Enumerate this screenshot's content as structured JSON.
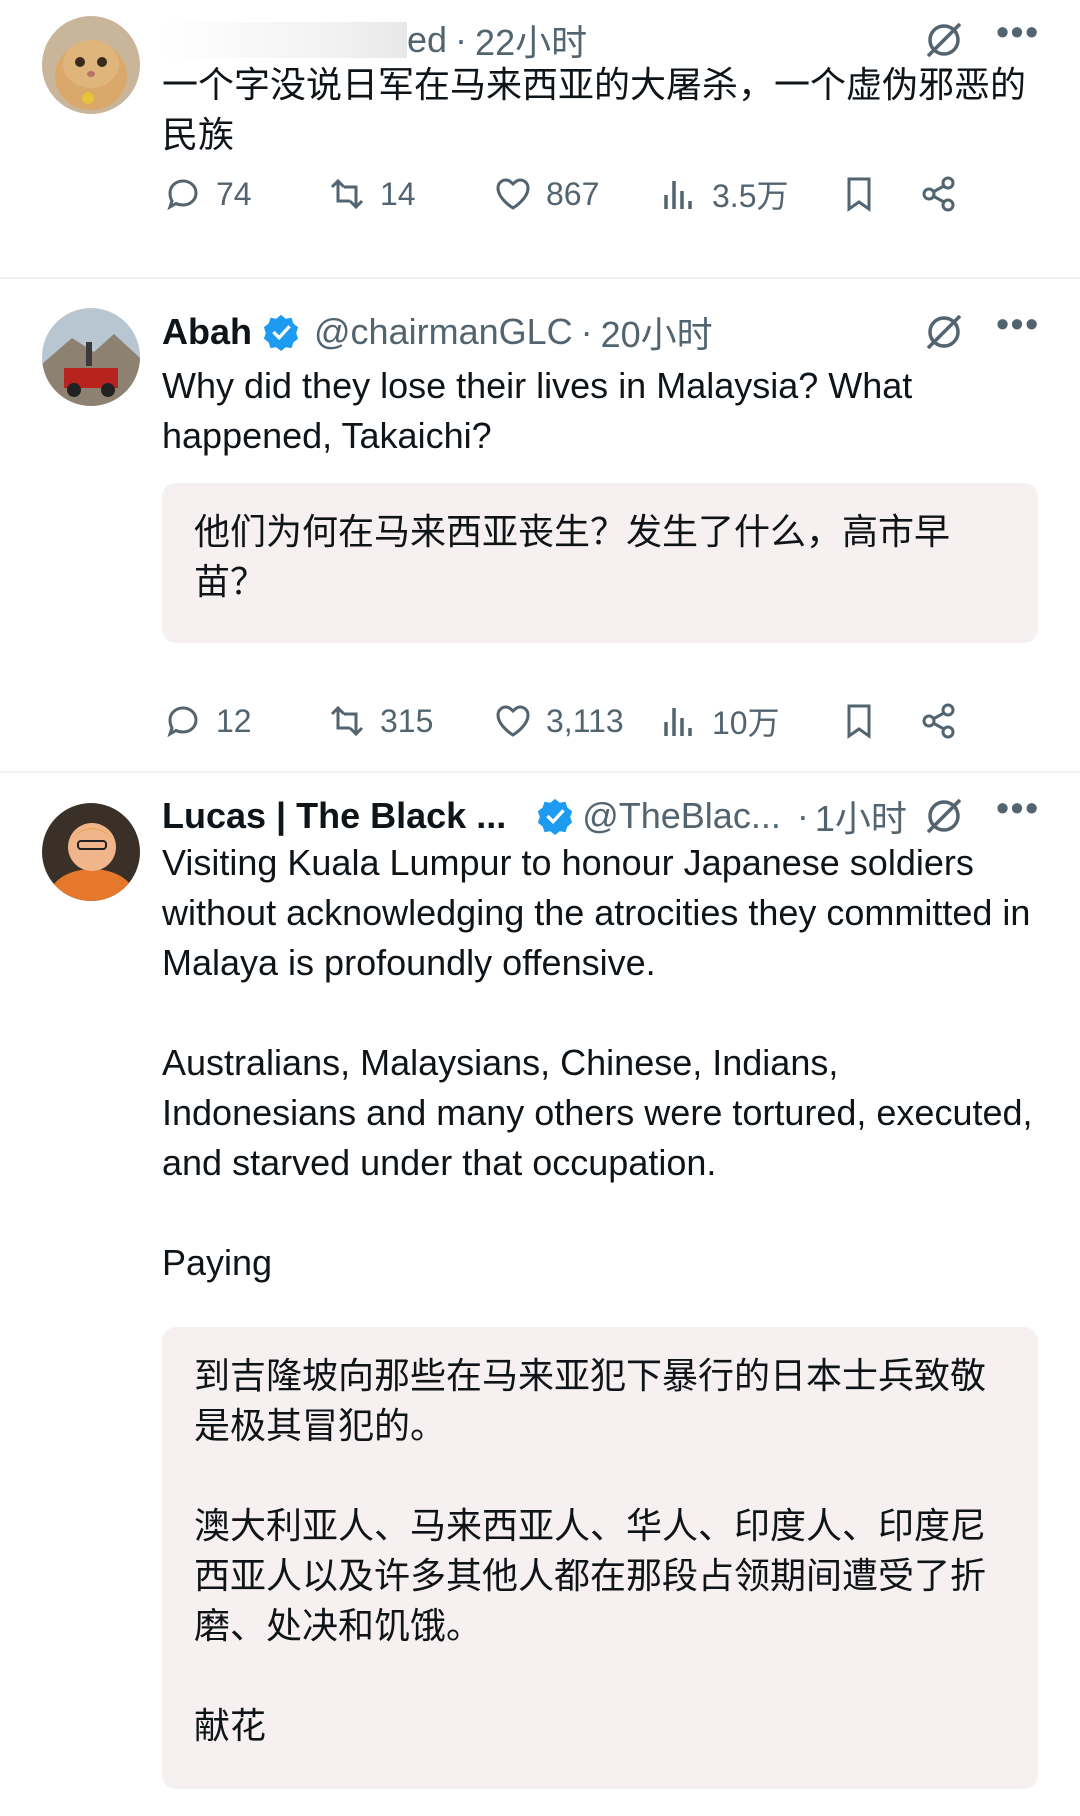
{
  "tweets": [
    {
      "name": "",
      "handle_partial": "ed",
      "time": "22小时",
      "text": "一个字没说日军在马来西亚的大屠杀，一个虚伪邪恶的民族",
      "replies": "74",
      "retweets": "14",
      "likes": "867",
      "views": "3.5万"
    },
    {
      "name": "Abah",
      "handle": "@chairmanGLC",
      "time": "20小时",
      "text": "Why did they lose their lives in Malaysia? What happened, Takaichi?",
      "translation": "他们为何在马来西亚丧生？发生了什么，高市早苗？",
      "replies": "12",
      "retweets": "315",
      "likes": "3,113",
      "views": "10万"
    },
    {
      "name": "Lucas | The Black ...",
      "handle": "@TheBlac...",
      "time": "1小时",
      "text": "Visiting Kuala Lumpur to honour Japanese soldiers without acknowledging the atrocities they committed in Malaya is profoundly offensive.\n\nAustralians, Malaysians, Chinese, Indians, Indonesians and many others were tortured, executed, and starved under that occupation.\n\nPaying",
      "translation": "到吉隆坡向那些在马来亚犯下暴行的日本士兵致敬是极其冒犯的。\n\n澳大利亚人、马来西亚人、华人、印度人、印度尼西亚人以及许多其他人都在那段占领期间遭受了折磨、处决和饥饿。\n\n献花"
    }
  ],
  "header": {
    "separator": "·",
    "more_label": "•••"
  },
  "colors": {
    "verified": "#1d9bf0",
    "secondary_text": "#536471",
    "translate_bg": "#f7f0f0"
  },
  "icons": [
    "reply-icon",
    "retweet-icon",
    "like-icon",
    "views-icon",
    "bookmark-icon",
    "share-icon",
    "grok-icon",
    "verified-badge-icon"
  ]
}
